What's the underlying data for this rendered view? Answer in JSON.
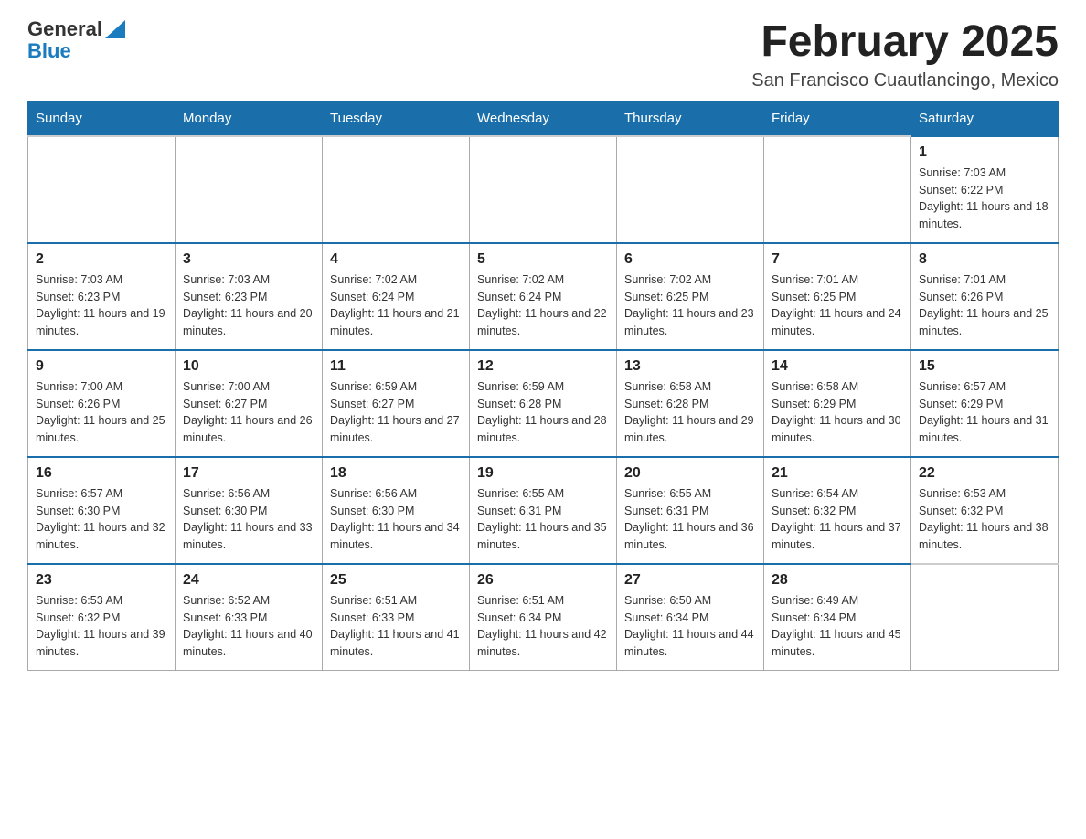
{
  "header": {
    "logo": {
      "general": "General",
      "blue": "Blue"
    },
    "title": "February 2025",
    "location": "San Francisco Cuautlancingo, Mexico"
  },
  "calendar": {
    "days_of_week": [
      "Sunday",
      "Monday",
      "Tuesday",
      "Wednesday",
      "Thursday",
      "Friday",
      "Saturday"
    ],
    "weeks": [
      [
        {
          "day": "",
          "info": ""
        },
        {
          "day": "",
          "info": ""
        },
        {
          "day": "",
          "info": ""
        },
        {
          "day": "",
          "info": ""
        },
        {
          "day": "",
          "info": ""
        },
        {
          "day": "",
          "info": ""
        },
        {
          "day": "1",
          "info": "Sunrise: 7:03 AM\nSunset: 6:22 PM\nDaylight: 11 hours and 18 minutes."
        }
      ],
      [
        {
          "day": "2",
          "info": "Sunrise: 7:03 AM\nSunset: 6:23 PM\nDaylight: 11 hours and 19 minutes."
        },
        {
          "day": "3",
          "info": "Sunrise: 7:03 AM\nSunset: 6:23 PM\nDaylight: 11 hours and 20 minutes."
        },
        {
          "day": "4",
          "info": "Sunrise: 7:02 AM\nSunset: 6:24 PM\nDaylight: 11 hours and 21 minutes."
        },
        {
          "day": "5",
          "info": "Sunrise: 7:02 AM\nSunset: 6:24 PM\nDaylight: 11 hours and 22 minutes."
        },
        {
          "day": "6",
          "info": "Sunrise: 7:02 AM\nSunset: 6:25 PM\nDaylight: 11 hours and 23 minutes."
        },
        {
          "day": "7",
          "info": "Sunrise: 7:01 AM\nSunset: 6:25 PM\nDaylight: 11 hours and 24 minutes."
        },
        {
          "day": "8",
          "info": "Sunrise: 7:01 AM\nSunset: 6:26 PM\nDaylight: 11 hours and 25 minutes."
        }
      ],
      [
        {
          "day": "9",
          "info": "Sunrise: 7:00 AM\nSunset: 6:26 PM\nDaylight: 11 hours and 25 minutes."
        },
        {
          "day": "10",
          "info": "Sunrise: 7:00 AM\nSunset: 6:27 PM\nDaylight: 11 hours and 26 minutes."
        },
        {
          "day": "11",
          "info": "Sunrise: 6:59 AM\nSunset: 6:27 PM\nDaylight: 11 hours and 27 minutes."
        },
        {
          "day": "12",
          "info": "Sunrise: 6:59 AM\nSunset: 6:28 PM\nDaylight: 11 hours and 28 minutes."
        },
        {
          "day": "13",
          "info": "Sunrise: 6:58 AM\nSunset: 6:28 PM\nDaylight: 11 hours and 29 minutes."
        },
        {
          "day": "14",
          "info": "Sunrise: 6:58 AM\nSunset: 6:29 PM\nDaylight: 11 hours and 30 minutes."
        },
        {
          "day": "15",
          "info": "Sunrise: 6:57 AM\nSunset: 6:29 PM\nDaylight: 11 hours and 31 minutes."
        }
      ],
      [
        {
          "day": "16",
          "info": "Sunrise: 6:57 AM\nSunset: 6:30 PM\nDaylight: 11 hours and 32 minutes."
        },
        {
          "day": "17",
          "info": "Sunrise: 6:56 AM\nSunset: 6:30 PM\nDaylight: 11 hours and 33 minutes."
        },
        {
          "day": "18",
          "info": "Sunrise: 6:56 AM\nSunset: 6:30 PM\nDaylight: 11 hours and 34 minutes."
        },
        {
          "day": "19",
          "info": "Sunrise: 6:55 AM\nSunset: 6:31 PM\nDaylight: 11 hours and 35 minutes."
        },
        {
          "day": "20",
          "info": "Sunrise: 6:55 AM\nSunset: 6:31 PM\nDaylight: 11 hours and 36 minutes."
        },
        {
          "day": "21",
          "info": "Sunrise: 6:54 AM\nSunset: 6:32 PM\nDaylight: 11 hours and 37 minutes."
        },
        {
          "day": "22",
          "info": "Sunrise: 6:53 AM\nSunset: 6:32 PM\nDaylight: 11 hours and 38 minutes."
        }
      ],
      [
        {
          "day": "23",
          "info": "Sunrise: 6:53 AM\nSunset: 6:32 PM\nDaylight: 11 hours and 39 minutes."
        },
        {
          "day": "24",
          "info": "Sunrise: 6:52 AM\nSunset: 6:33 PM\nDaylight: 11 hours and 40 minutes."
        },
        {
          "day": "25",
          "info": "Sunrise: 6:51 AM\nSunset: 6:33 PM\nDaylight: 11 hours and 41 minutes."
        },
        {
          "day": "26",
          "info": "Sunrise: 6:51 AM\nSunset: 6:34 PM\nDaylight: 11 hours and 42 minutes."
        },
        {
          "day": "27",
          "info": "Sunrise: 6:50 AM\nSunset: 6:34 PM\nDaylight: 11 hours and 44 minutes."
        },
        {
          "day": "28",
          "info": "Sunrise: 6:49 AM\nSunset: 6:34 PM\nDaylight: 11 hours and 45 minutes."
        },
        {
          "day": "",
          "info": ""
        }
      ]
    ]
  }
}
